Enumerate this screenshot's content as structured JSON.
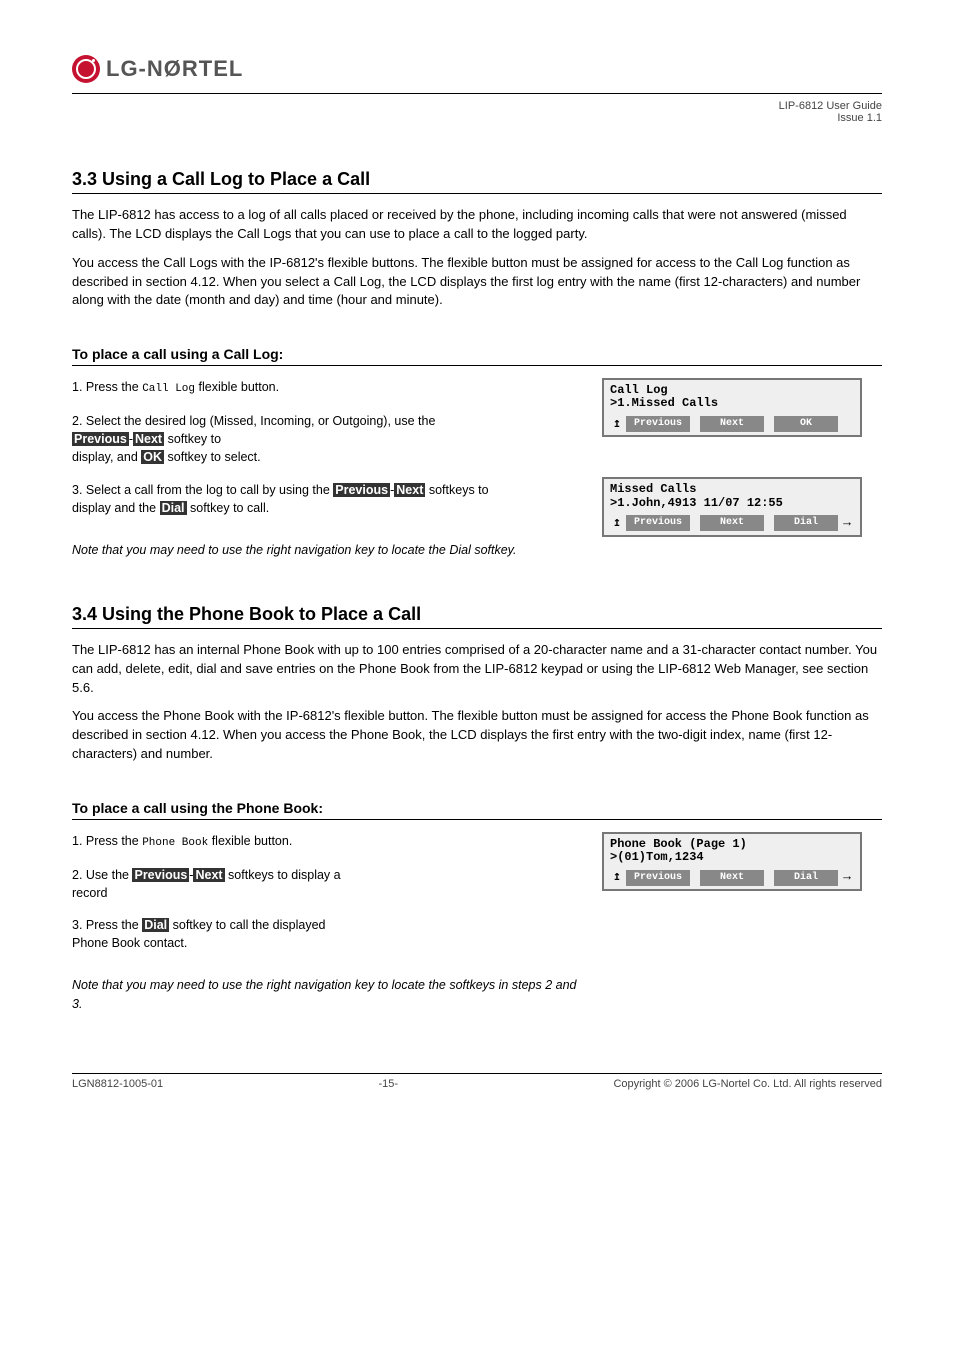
{
  "logo_text": "LG-NØRTEL",
  "header": {
    "product": "LIP-6812 User Guide",
    "issue": "Issue 1.1"
  },
  "section33": {
    "title": "3.3 Using a Call Log to Place a Call",
    "para1": "The LIP-6812 has access to a log of all calls placed or received by the phone, including incoming calls that were not answered (missed calls). The LCD displays the Call Logs that you can use to place a call to the logged party.",
    "para2": "You access the Call Logs with the IP-6812's flexible buttons. The flexible button must be assigned for access to the Call Log function as described in section 4.12. When you select a Call Log, the LCD displays the first log entry with the name (first 12-characters) and number along with the date (month and day) and time (hour and minute).",
    "to_title": "To place a call using a Call Log:",
    "step1a": "Press the",
    "step1b": "flexible button.",
    "step2a": "Select the desired log (Missed, Incoming, or Outgoing), use the",
    "step2mid": "-",
    "step2b": "softkey to",
    "step2c": "display, and",
    "step2d": "softkey to select.",
    "step3a": "Select a call from the log to call by using the",
    "step3mid": "-",
    "step3b": "softkeys to",
    "step3c": "display and the",
    "step3d": "softkey to call.",
    "note": "Note that you may need to use the right navigation key to locate the Dial softkey.",
    "softkeys": {
      "prev": "Previous",
      "next": "Next",
      "ok": "OK",
      "dial": "Dial"
    },
    "callout": "Call Log"
  },
  "lcd1": {
    "l1": "Call Log",
    "l2": ">1.Missed Calls",
    "b1": "Previous",
    "b2": "Next",
    "b3": "OK"
  },
  "lcd2": {
    "l1": "Missed Calls",
    "l2": ">1.John,4913 11/07 12:55",
    "b1": "Previous",
    "b2": "Next",
    "b3": "Dial"
  },
  "section34": {
    "title": "3.4 Using the Phone Book to Place a Call",
    "para1": "The LIP-6812 has an internal Phone Book with up to 100 entries comprised of a 20-character name and a 31-character contact number. You can add, delete, edit, dial and save entries on the Phone Book from the LIP-6812 keypad or using the LIP-6812 Web Manager, see section 5.6.",
    "para2": "You access the Phone Book with the IP-6812's flexible button. The flexible button must be assigned for access the Phone Book function as described in section 4.12. When you access the Phone Book, the LCD displays the first entry with the two-digit index, name (first 12-characters) and number.",
    "to_title": "To place a call using the Phone Book:",
    "step1a": "Press the",
    "step1b": "flexible button.",
    "step2a": "Use the",
    "step2mid": "-",
    "step2b": "softkeys to display a",
    "step2c": "record",
    "step3a": "Press the",
    "step3b": "softkey to call the displayed",
    "step3c": "Phone Book contact.",
    "note": "Note that you may need to use the right navigation key to locate the softkeys in steps 2 and 3.",
    "softkeys": {
      "prev": "Previous",
      "next": "Next",
      "dial": "Dial"
    },
    "callout": "Phone Book"
  },
  "lcd3": {
    "l1": "Phone Book (Page 1)",
    "l2": ">(01)Tom,1234",
    "b1": "Previous",
    "b2": "Next",
    "b3": "Dial"
  },
  "footer": {
    "left": "LGN8812-1005-01",
    "center": "-15-",
    "right": "Copyright © 2006 LG-Nortel Co. Ltd. All rights reserved"
  }
}
